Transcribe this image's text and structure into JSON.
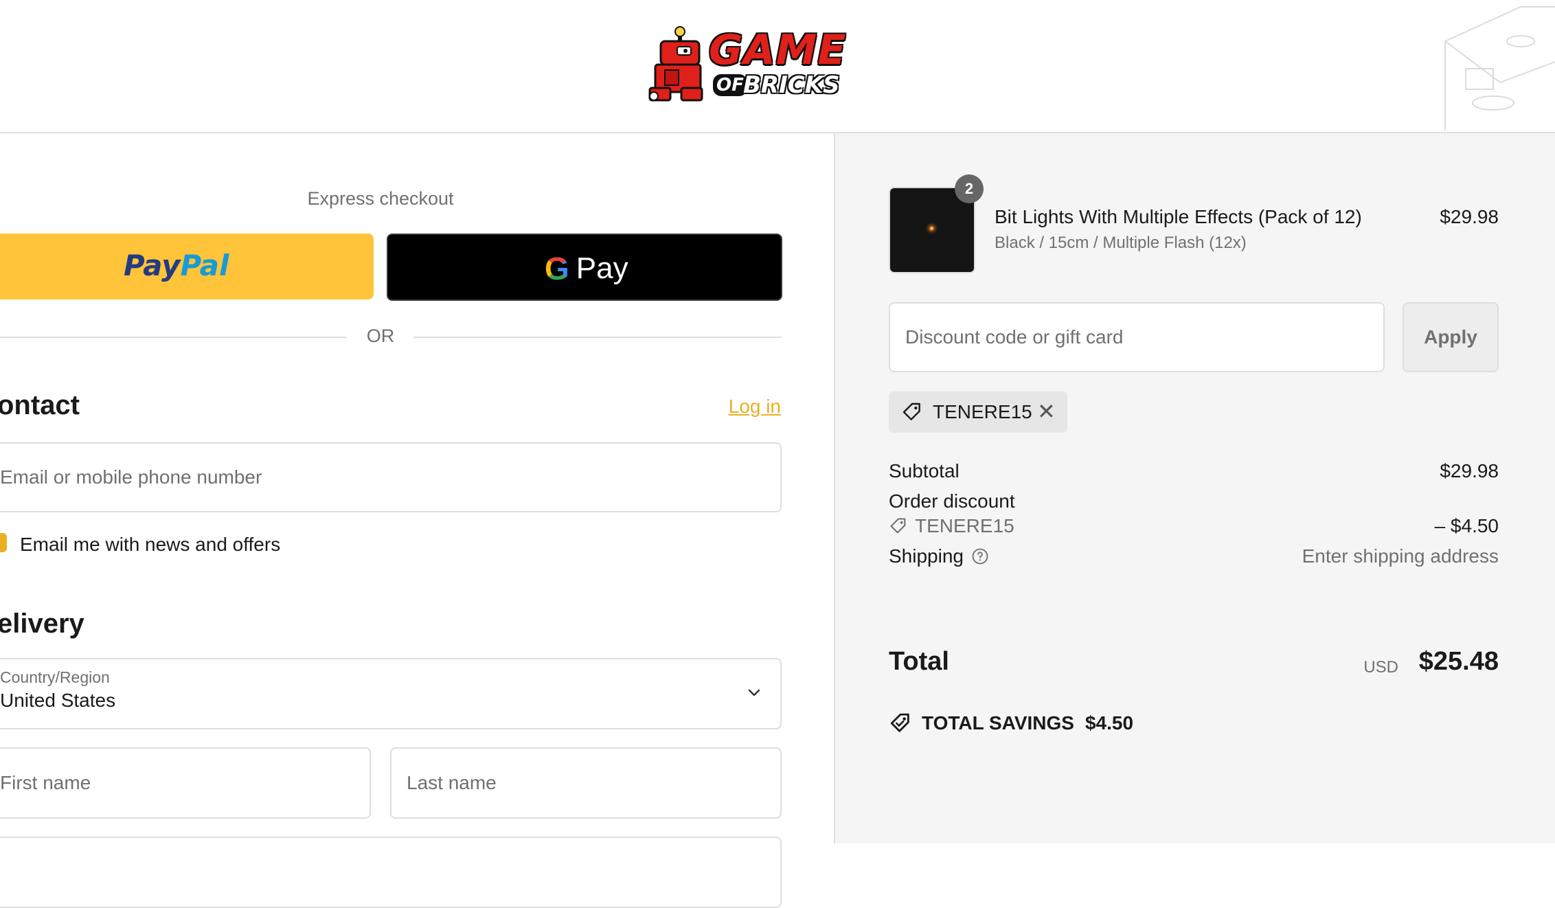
{
  "header": {
    "logo": {
      "line1": "GAME",
      "line2a": "OF",
      "line2b": "BRICKS"
    }
  },
  "express": {
    "title": "Express checkout",
    "paypal_a": "Pay",
    "paypal_b": "Pal",
    "gpay_g": "G",
    "gpay_pay": "Pay",
    "or": "OR"
  },
  "contact": {
    "heading": "ontact",
    "login": "Log in",
    "email_placeholder": "Email or mobile phone number",
    "newsletter_label": "Email me with news and offers",
    "newsletter_checked": true
  },
  "delivery": {
    "heading": "elivery",
    "country_label": "Country/Region",
    "country_value": "United States",
    "first_name_placeholder": "First name",
    "last_name_placeholder": "Last name"
  },
  "summary": {
    "item": {
      "quantity": "2",
      "title": "Bit Lights With Multiple Effects (Pack of 12)",
      "variant": "Black / 15cm / Multiple Flash (12x)",
      "price": "$29.98"
    },
    "discount_placeholder": "Discount code or gift card",
    "apply_label": "Apply",
    "applied_code": "TENERE15",
    "subtotal_label": "Subtotal",
    "subtotal_value": "$29.98",
    "order_discount_label": "Order discount",
    "order_discount_code": "TENERE15",
    "order_discount_value": "– $4.50",
    "shipping_label": "Shipping",
    "shipping_value": "Enter shipping address",
    "total_label": "Total",
    "total_currency": "USD",
    "total_value": "$25.48",
    "savings_label": "TOTAL SAVINGS",
    "savings_value": "$4.50"
  },
  "colors": {
    "accent": "#e9b023",
    "paypal_yellow": "#ffc439",
    "logo_red": "#e0201b"
  }
}
